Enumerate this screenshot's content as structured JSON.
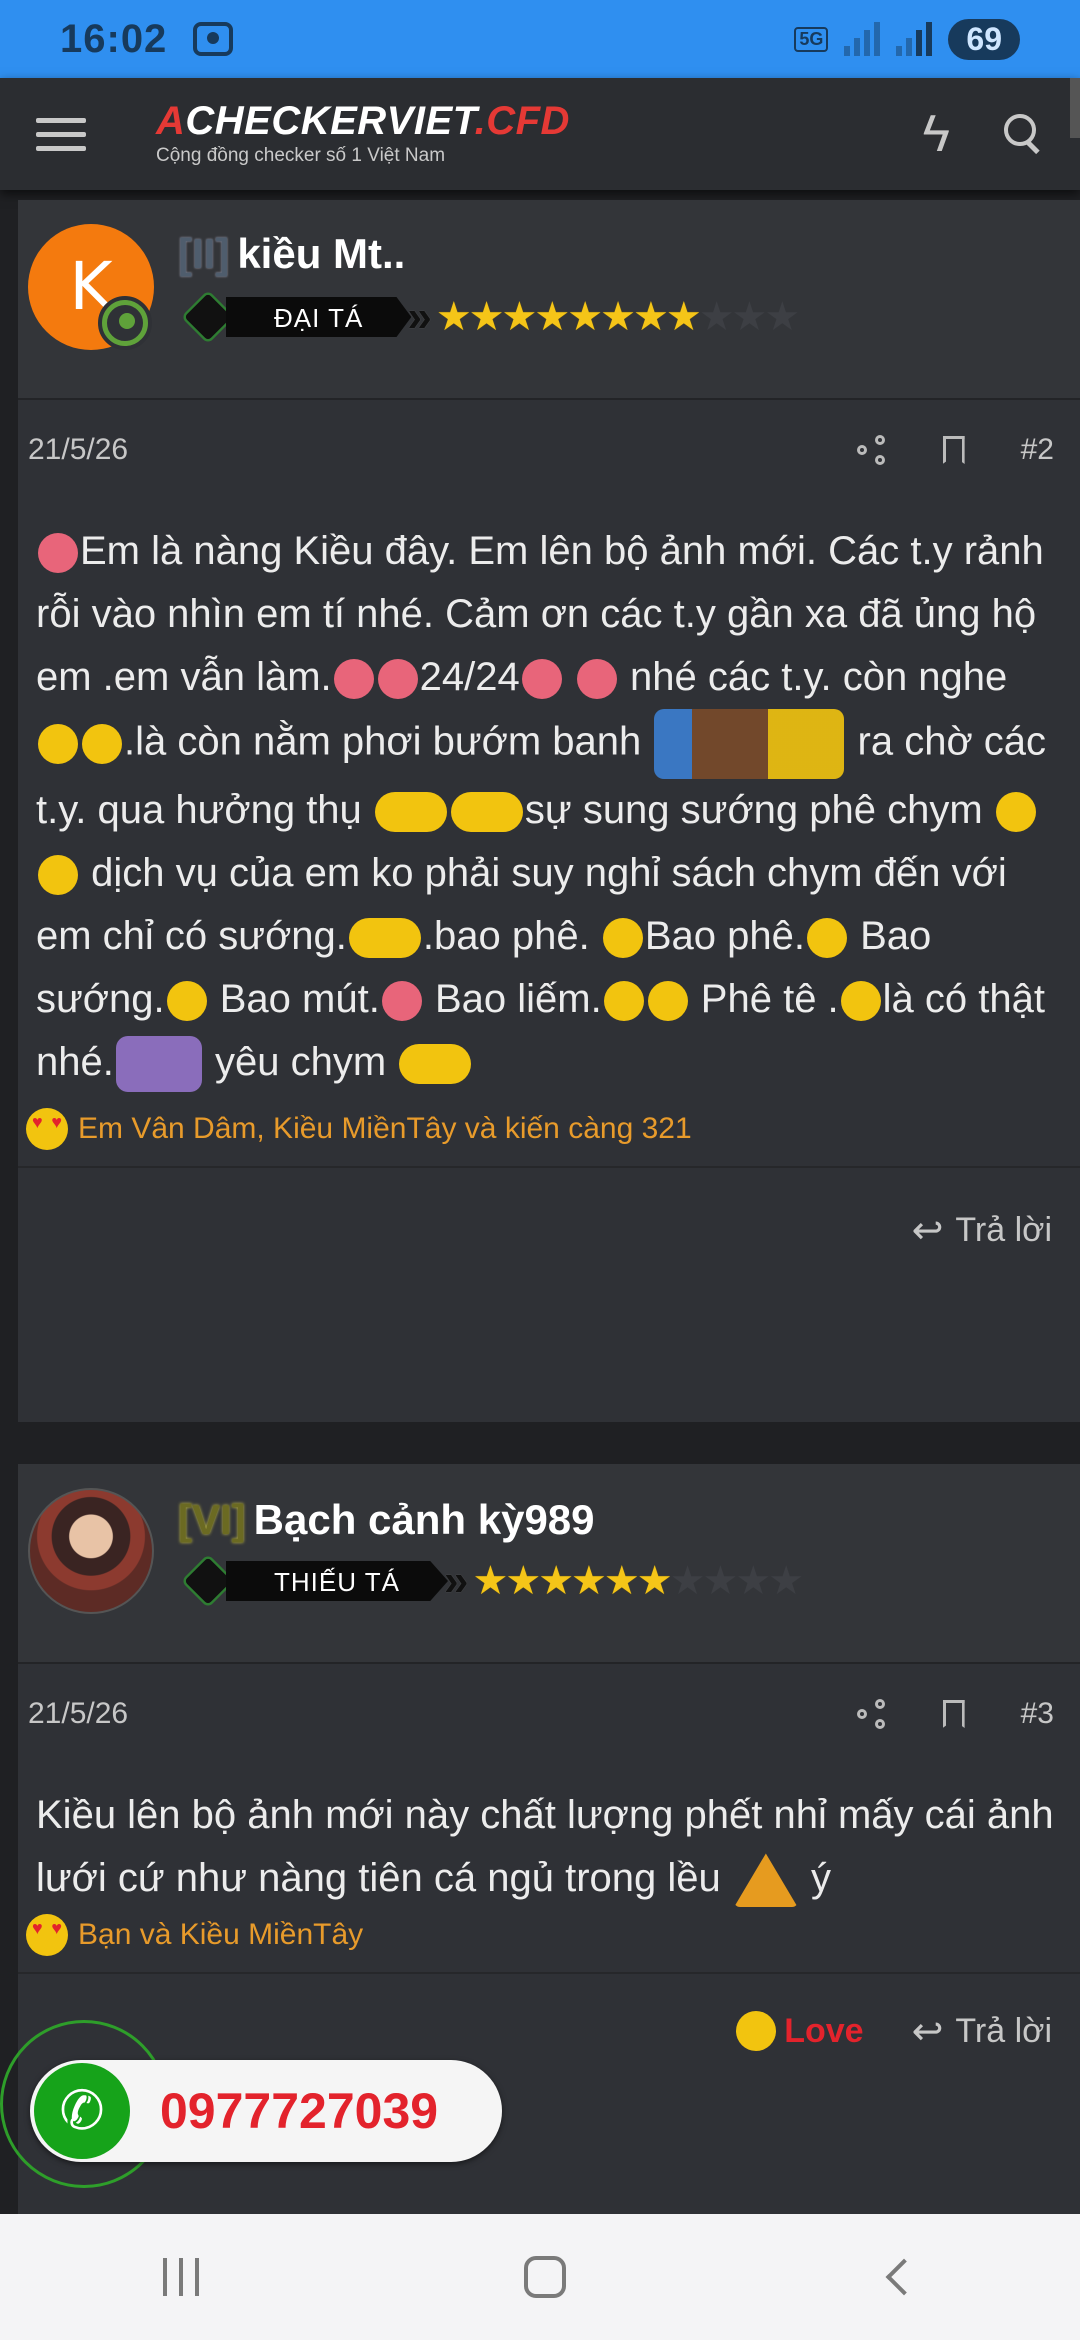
{
  "status_bar": {
    "time": "16:02",
    "network": "5G",
    "battery": "69"
  },
  "header": {
    "logo_prefix": "A",
    "logo_main": "CHECKERVIET",
    "logo_suffix": ".CFD",
    "tagline": "Cộng đồng checker số 1 Việt Nam"
  },
  "posts": [
    {
      "avatar_letter": "K",
      "level": "[II]",
      "username": "kiều Mt..",
      "rank": "ĐẠI TÁ",
      "stars_on": "★★★★★★★★",
      "stars_off": "★★★",
      "date": "21/5/26",
      "number": "#2",
      "content": {
        "l1": "Em là nàng Kiều đây. Em lên bộ ảnh mới. Các t.y rảnh rỗi vào nhìn em tí nhé. Cảm ơn các t.y gần xa đã ủng hộ em .em vẫn làm.",
        "l2": "24/24",
        "l3": " nhé các t.y. còn nghe ",
        "l4": ".là còn nằm phơi bướm banh ",
        "l5": " ra chờ các t.y. qua hưởng thụ ",
        "l6": "sự sung sướng phê chym ",
        "l7": " dịch vụ của em ko phải suy nghỉ sách chym đến với em chỉ có sướng.",
        "l8": ".bao phê. ",
        "l9": "Bao phê.",
        "l10": " Bao sướng.",
        "l11": " Bao mút.",
        "l12": "  Bao liếm.",
        "l13": " Phê tê .",
        "l14": "là có thật nhé.",
        "l15": " yêu chym "
      },
      "reactions": "Em Vân Dâm, Kiều MiềnTây và kiến càng 321",
      "reply_label": "Trả lời"
    },
    {
      "level": "[VI]",
      "username": "Bạch cảnh kỳ989",
      "rank": "THIẾU TÁ",
      "stars_on": "★★★★★★",
      "stars_off": "★★★★",
      "date": "21/5/26",
      "number": "#3",
      "content": {
        "l1": "Kiều lên bộ ảnh mới này chất lượng phết nhỉ mấy cái ảnh lưới cứ như nàng tiên cá ngủ trong lều ",
        "l2": " ý"
      },
      "reactions": "Bạn và Kiều MiềnTây",
      "love_label": "Love",
      "reply_label": "Trả lời"
    }
  ],
  "floating_call": {
    "phone": "0977727039"
  }
}
